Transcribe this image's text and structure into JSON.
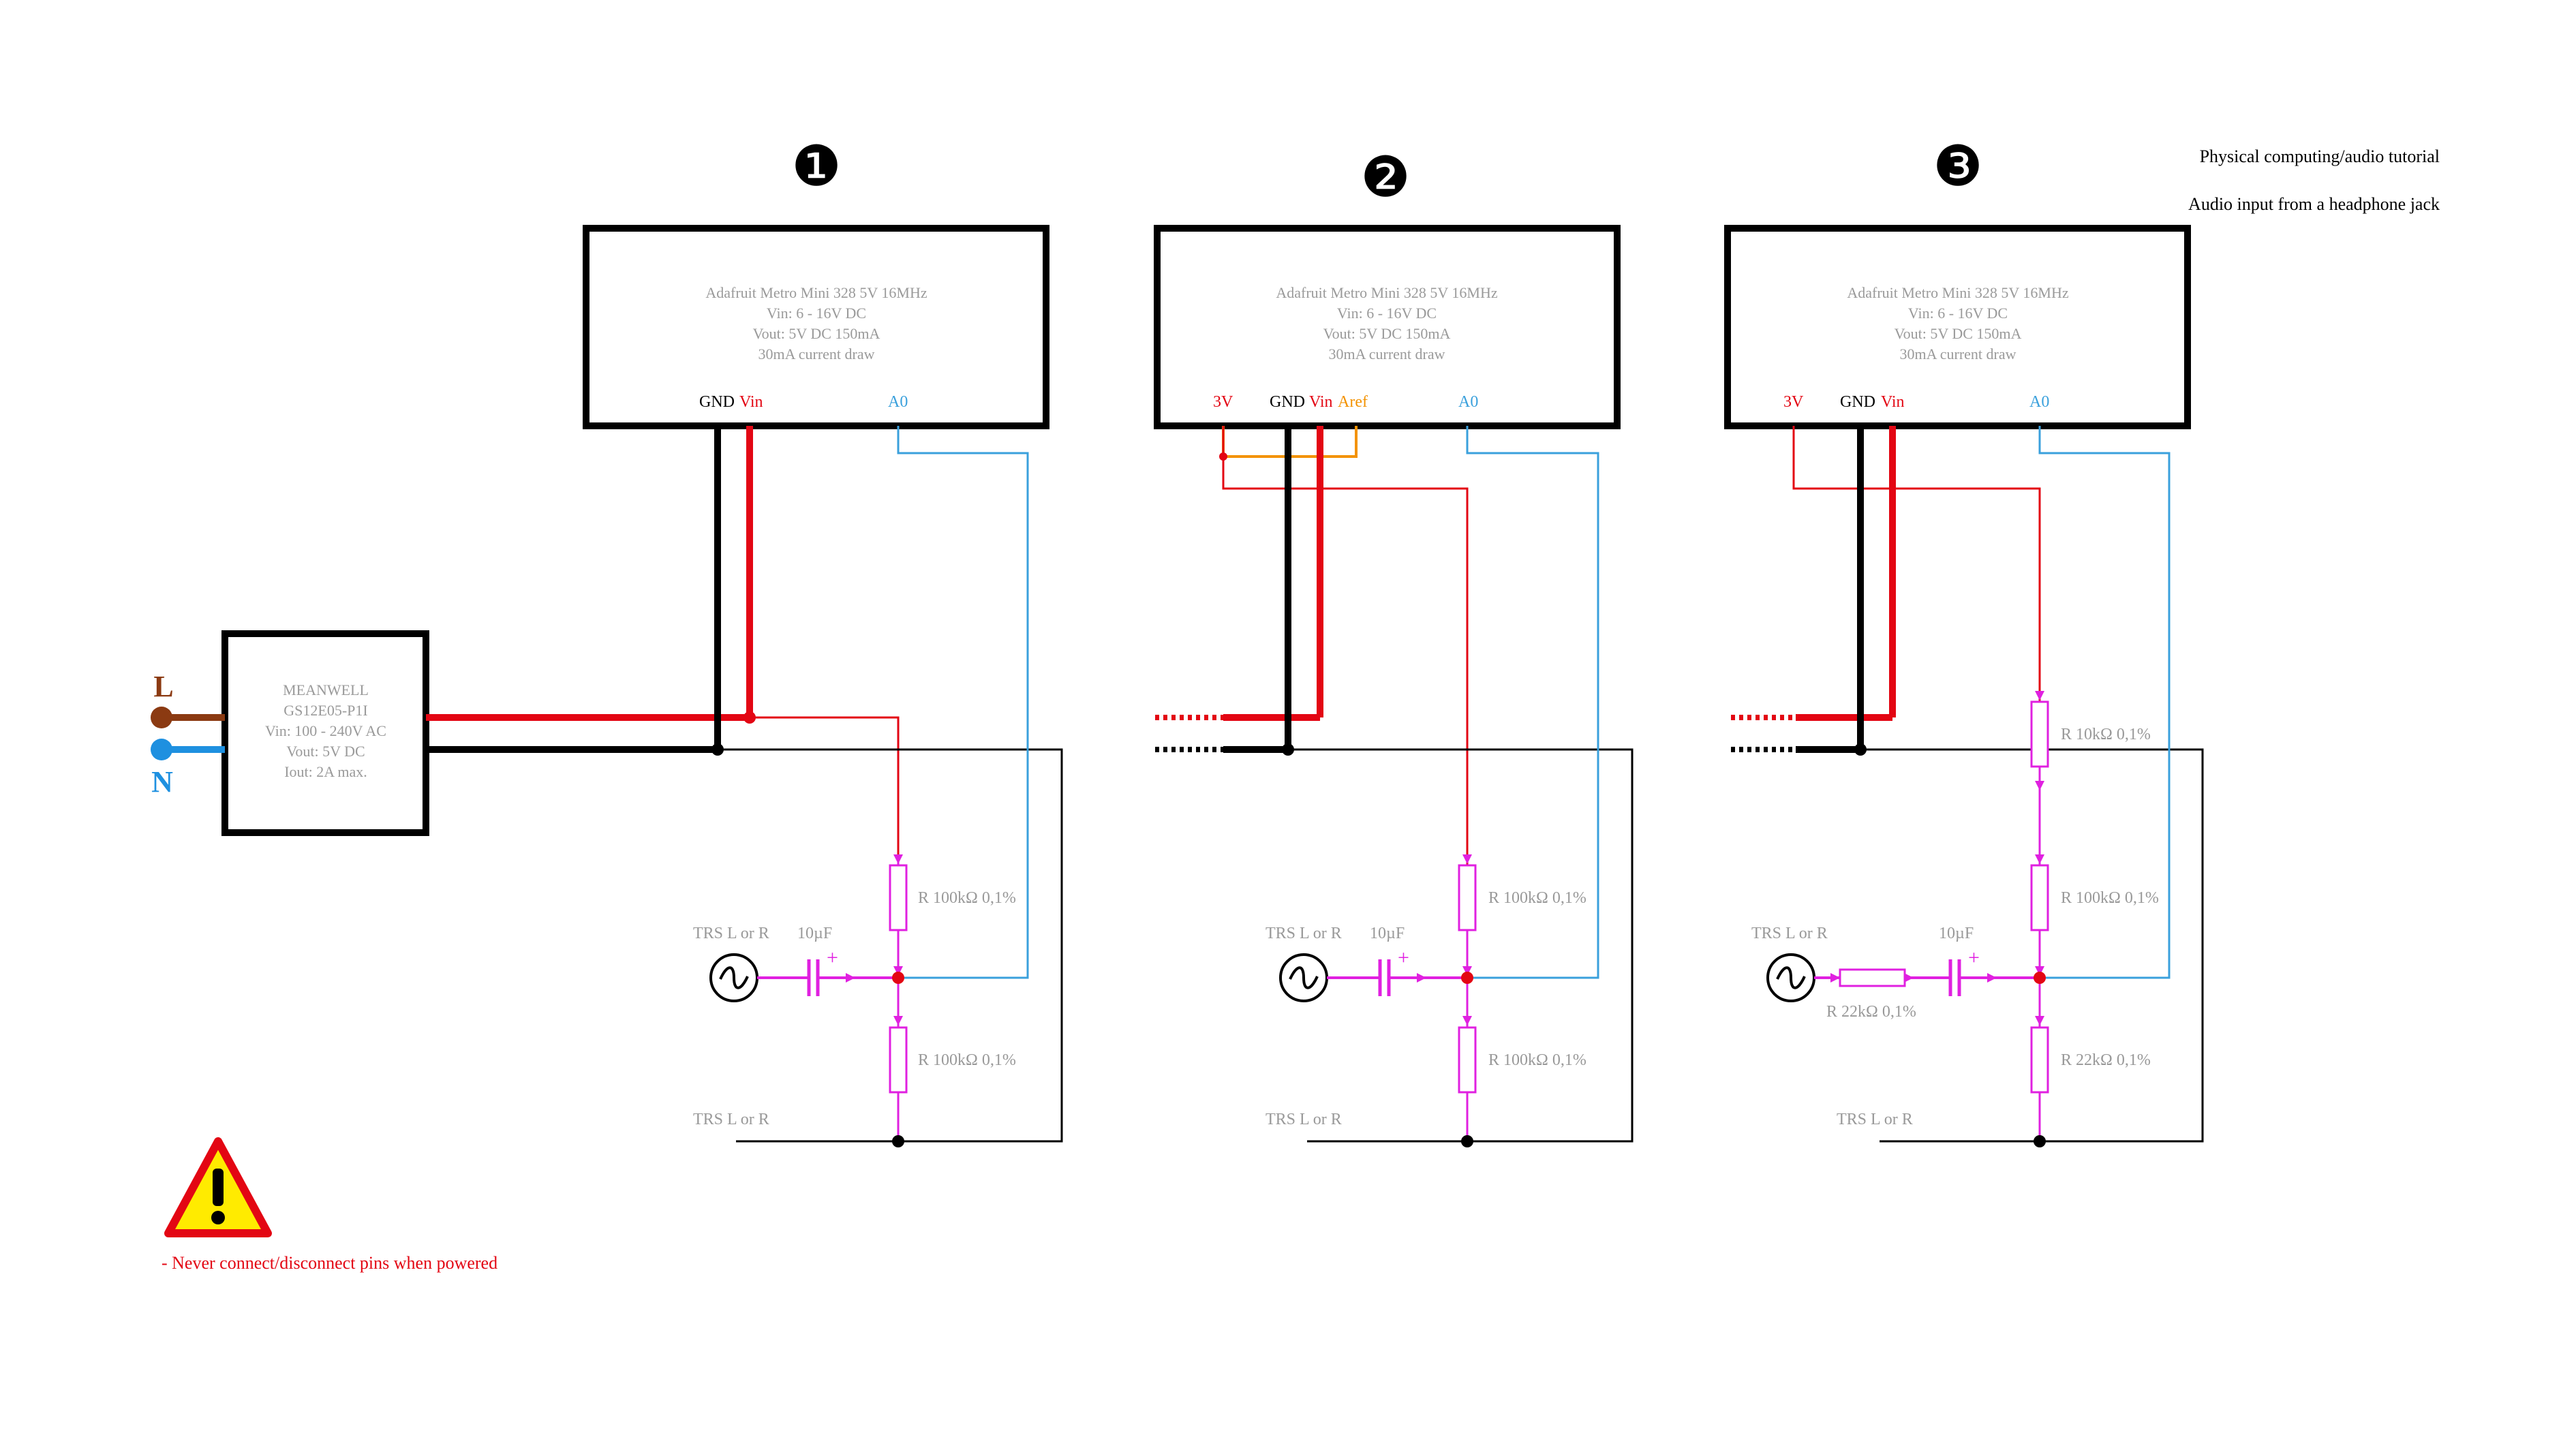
{
  "header": {
    "line1": "Physical computing/audio tutorial",
    "line2": "Audio input from a headphone jack"
  },
  "power_supply": {
    "line1": "MEANWELL",
    "line2": "GS12E05-P1I",
    "line3": "Vin: 100 - 240V AC",
    "line4": "Vout: 5V DC",
    "line5": "Iout: 2A max.",
    "live_label": "L",
    "neutral_label": "N"
  },
  "board": {
    "line1": "Adafruit Metro Mini 328 5V 16MHz",
    "line2": "Vin: 6 - 16V DC",
    "line3": "Vout: 5V DC 150mA",
    "line4": "30mA current draw"
  },
  "circuit1": {
    "number": "❶",
    "pin_gnd": "GND",
    "pin_vin": "Vin",
    "pin_a0": "A0",
    "r_top": "R 100kΩ 0,1%",
    "r_bottom": "R 100kΩ 0,1%",
    "source": "TRS L or R",
    "cap": "10µF",
    "ground_ref": "TRS L or R"
  },
  "circuit2": {
    "number": "❷",
    "pin_3v": "3V",
    "pin_gnd": "GND",
    "pin_vin": "Vin",
    "pin_aref": "Aref",
    "pin_a0": "A0",
    "r_top": "R 100kΩ 0,1%",
    "r_bottom": "R 100kΩ 0,1%",
    "source": "TRS L or R",
    "cap": "10µF",
    "ground_ref": "TRS L or R"
  },
  "circuit3": {
    "number": "❸",
    "pin_3v": "3V",
    "pin_gnd": "GND",
    "pin_vin": "Vin",
    "pin_a0": "A0",
    "r_pot": "R 10kΩ 0,1%",
    "r_top": "R 100kΩ 0,1%",
    "r_series": "R 22kΩ  0,1%",
    "r_bottom": "R 22kΩ  0,1%",
    "source": "TRS L or R",
    "cap": "10µF",
    "ground_ref": "TRS L or R"
  },
  "warning": {
    "text": "- Never connect/disconnect pins when powered"
  },
  "colors": {
    "wire_power": "#e30613",
    "wire_ground": "#000000",
    "wire_signal": "#3aa0dc",
    "wire_aref": "#f39200",
    "component": "#e020e0",
    "live": "#8b3a12",
    "neutral": "#1e90e0",
    "warning_fill": "#ffeb00",
    "warning_border": "#e30613"
  }
}
